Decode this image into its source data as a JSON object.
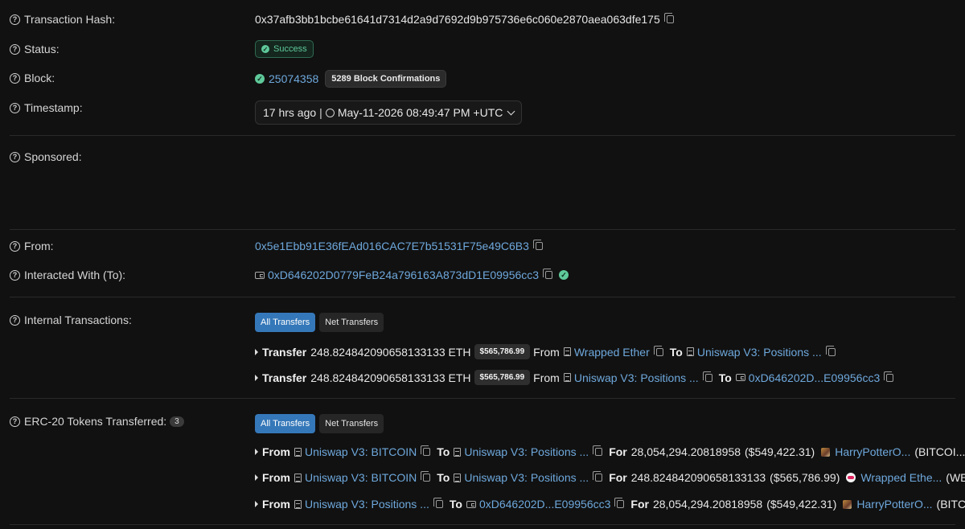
{
  "tx": {
    "hash_label": "Transaction Hash:",
    "hash": "0x37afb3bb1bcbe61641d7314d2a9d7692d9b975736e6c060e2870aea063dfe175",
    "status_label": "Status:",
    "status": "Success",
    "block_label": "Block:",
    "block": "25074358",
    "confirmations": "5289 Block Confirmations",
    "timestamp_label": "Timestamp:",
    "age": "17 hrs ago",
    "separator": "|",
    "timestamp": "May-11-2026 08:49:47 PM +UTC",
    "sponsored_label": "Sponsored:",
    "from_label": "From:",
    "from": "0x5e1Ebb91E36fEAd016CAC7E7b51531F75e49C6B3",
    "to_label": "Interacted With (To):",
    "to": "0xD646202D0779FeB24a796163A873dD1E09956cc3"
  },
  "internal": {
    "label": "Internal Transactions:",
    "tab_all": "All Transfers",
    "tab_net": "Net Transfers",
    "rows": [
      {
        "kw": "Transfer",
        "amount": "248.824842090658133133 ETH",
        "usd": "$565,786.99",
        "from_kw": "From",
        "from": "Wrapped Ether",
        "to_kw": "To",
        "to": "Uniswap V3: Positions ..."
      },
      {
        "kw": "Transfer",
        "amount": "248.824842090658133133 ETH",
        "usd": "$565,786.99",
        "from_kw": "From",
        "from": "Uniswap V3: Positions ...",
        "to_kw": "To",
        "to": "0xD646202D...E09956cc3"
      }
    ]
  },
  "erc20": {
    "label": "ERC-20 Tokens Transferred:",
    "count": "3",
    "tab_all": "All Transfers",
    "tab_net": "Net Transfers",
    "rows": [
      {
        "from_kw": "From",
        "from": "Uniswap V3: BITCOIN",
        "to_kw": "To",
        "to": "Uniswap V3: Positions ...",
        "for_kw": "For",
        "amount": "28,054,294.20818958",
        "usd": "($549,422.31)",
        "token": "HarryPotterO...",
        "symbol": "(BITCOI...)"
      },
      {
        "from_kw": "From",
        "from": "Uniswap V3: BITCOIN",
        "to_kw": "To",
        "to": "Uniswap V3: Positions ...",
        "for_kw": "For",
        "amount": "248.824842090658133133",
        "usd": "($565,786.99)",
        "token": "Wrapped Ethe...",
        "symbol": "(WETH)"
      },
      {
        "from_kw": "From",
        "from": "Uniswap V3: Positions ...",
        "to_kw": "To",
        "to": "0xD646202D...E09956cc3",
        "for_kw": "For",
        "amount": "28,054,294.20818958",
        "usd": "($549,422.31)",
        "token": "HarryPotterO...",
        "symbol": "(BITCOI...)"
      }
    ]
  }
}
